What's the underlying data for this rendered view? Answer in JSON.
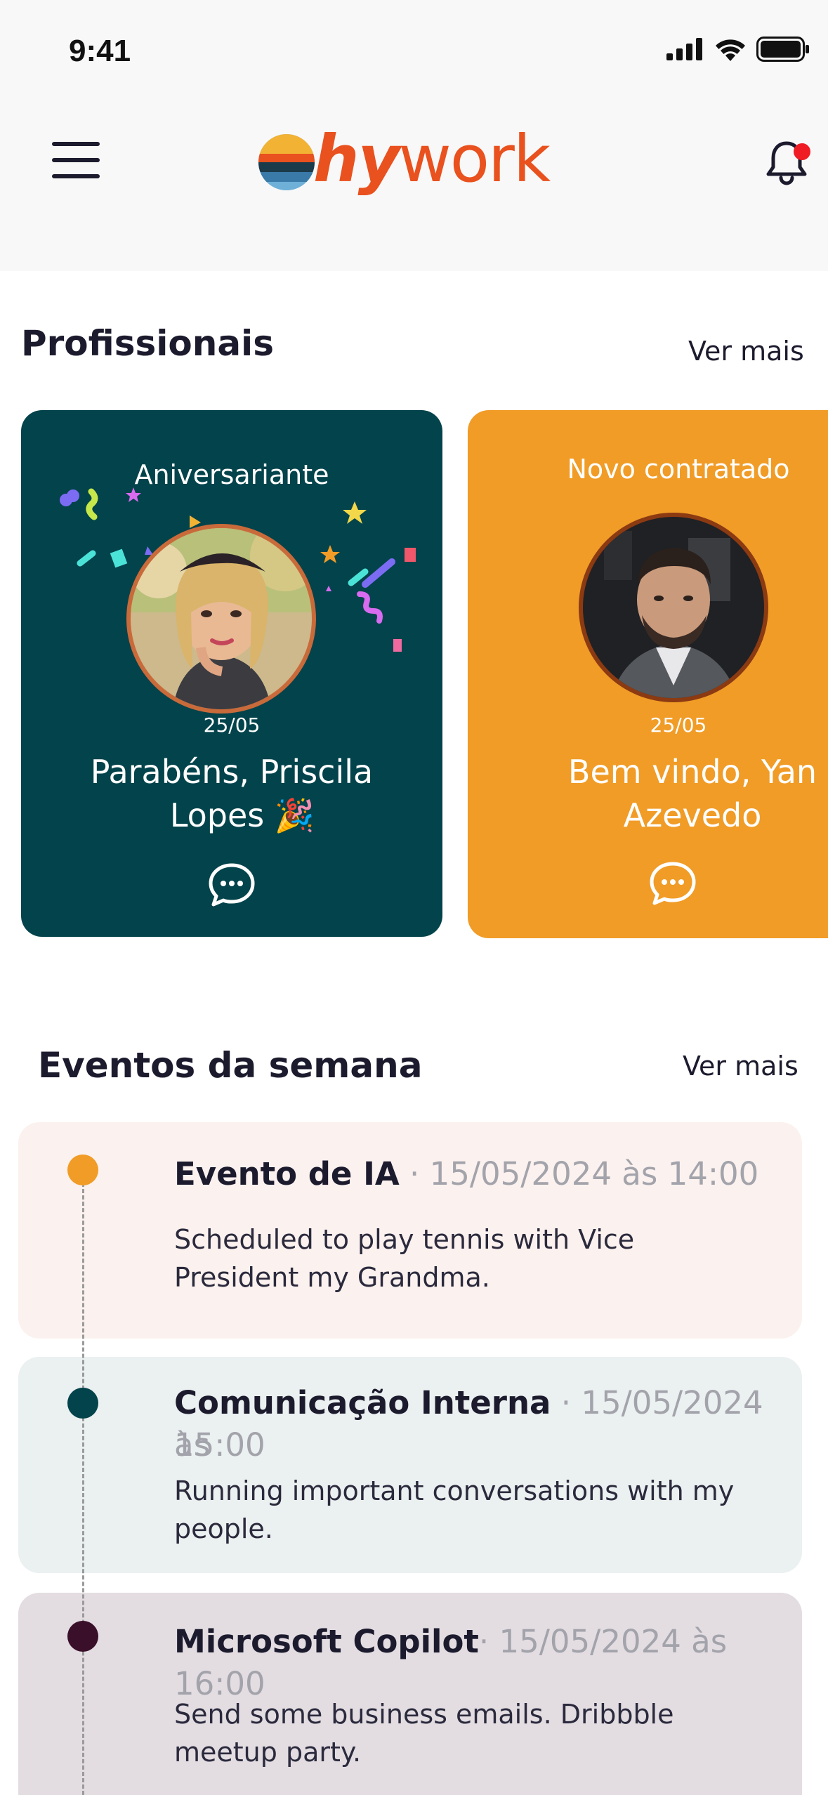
{
  "status_bar": {
    "time": "9:41"
  },
  "header": {
    "logo_hy": "hy",
    "logo_work": "work",
    "has_notification": true
  },
  "profissionais": {
    "title": "Profissionais",
    "see_more": "Ver mais",
    "cards": [
      {
        "label": "Aniversariante",
        "date": "25/05",
        "message_line1": "Parabéns, Priscila",
        "message_line2": "Lopes 🎉",
        "color": "#03434b"
      },
      {
        "label": "Novo contratado",
        "date": "25/05",
        "message_line1": "Bem vindo, Yan",
        "message_line2": "Azevedo",
        "color": "#f09c27"
      }
    ]
  },
  "eventos": {
    "title": "Eventos da semana",
    "see_more": "Ver mais",
    "items": [
      {
        "name": "Evento de IA",
        "when": " · 15/05/2024 às 14:00",
        "desc_line1": "Scheduled to play tennis with Vice",
        "desc_line2": "President my Grandma.",
        "bg": "#fbf1ee",
        "dot": "#f09c27"
      },
      {
        "name": "Comunicação Interna",
        "when_line1": " · 15/05/2024 às",
        "when_line2": "15:00",
        "desc_line1": "Running important conversations with my",
        "desc_line2": "people.",
        "bg": "#ebf0f0",
        "dot": "#03434b"
      },
      {
        "name": "Microsoft Copilot",
        "when": "· 15/05/2024 às 16:00",
        "desc_line1": "Send some business emails. Dribbble",
        "desc_line2": "meetup party.",
        "bg": "#e3dde2",
        "dot": "#3a0f2a"
      }
    ]
  }
}
